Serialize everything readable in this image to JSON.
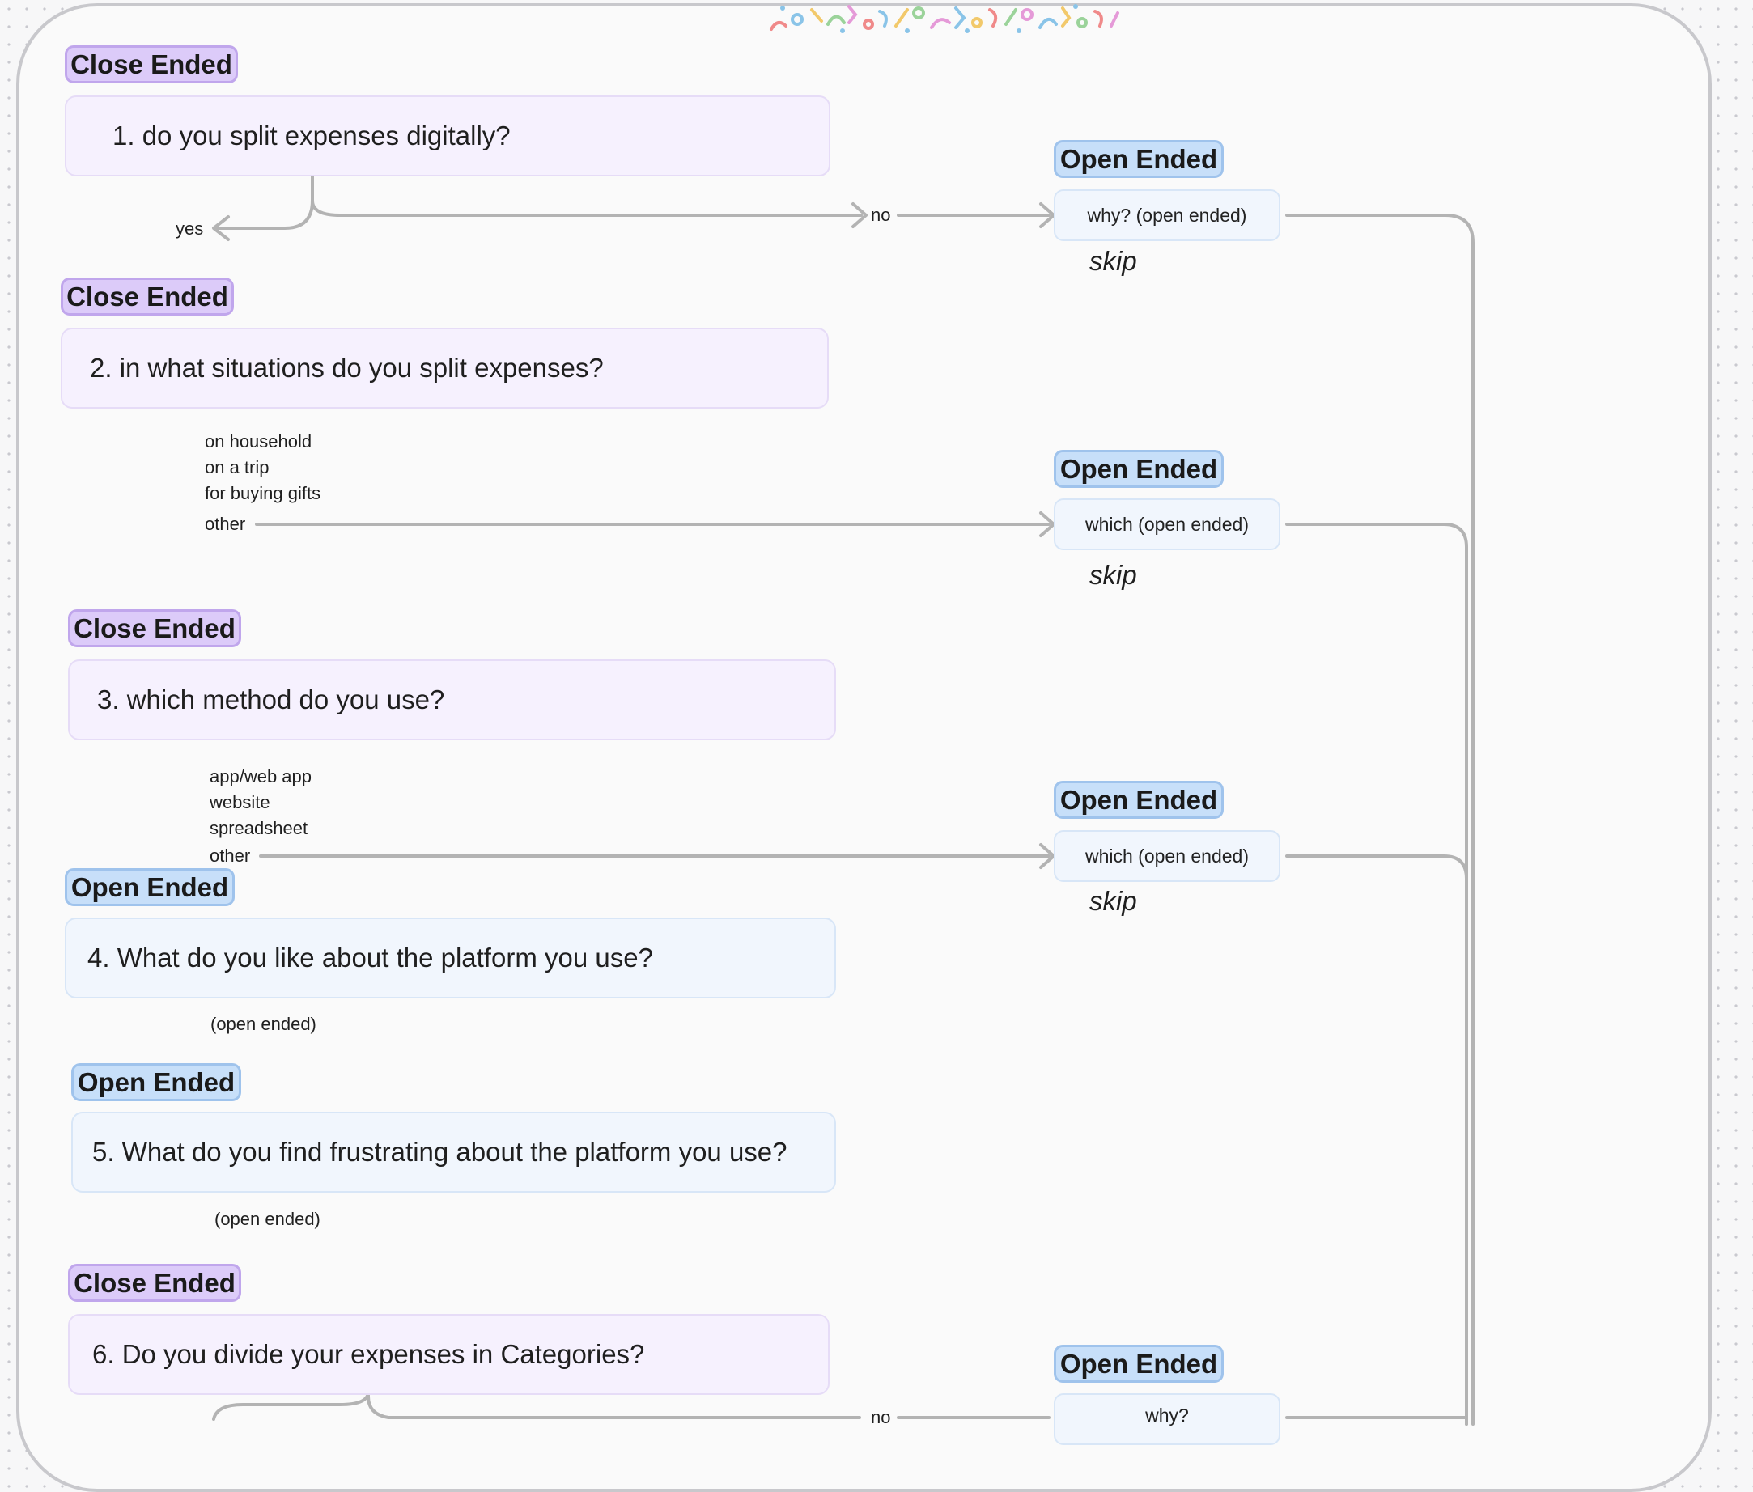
{
  "colors": {
    "close_tag_fill": "#dccbf9",
    "open_tag_fill": "#c7dff9",
    "close_box_fill": "#f6f1fe",
    "open_box_fill": "#f1f6fd",
    "connector": "#b3b3b3"
  },
  "tags": {
    "close": "Close Ended",
    "open": "Open Ended"
  },
  "questions": {
    "q1": "1.  do you split expenses digitally?",
    "q2": "2. in what situations do you split expenses?",
    "q3": "3. which method do you use?",
    "q4": "4. What do you like about the platform you use?",
    "q5": "5. What do you find frustrating about the platform you use?",
    "q6": "6. Do you divide your expenses in Categories?"
  },
  "q1_branches": {
    "yes": "yes",
    "no": "no",
    "follow_up": "why? (open ended)",
    "skip": "skip"
  },
  "q2_options": {
    "opt1": "on household",
    "opt2": "on a trip",
    "opt3": "for buying gifts",
    "opt4": "other",
    "follow_up": "which (open ended)",
    "skip": "skip"
  },
  "q3_options": {
    "opt1": "app/web app",
    "opt2": "website",
    "opt3": "spreadsheet",
    "opt4": "other",
    "follow_up": "which (open ended)",
    "skip": "skip"
  },
  "q4_answer": "(open ended)",
  "q5_answer": "(open ended)",
  "q6_branches": {
    "no": "no",
    "follow_up": "why?"
  }
}
